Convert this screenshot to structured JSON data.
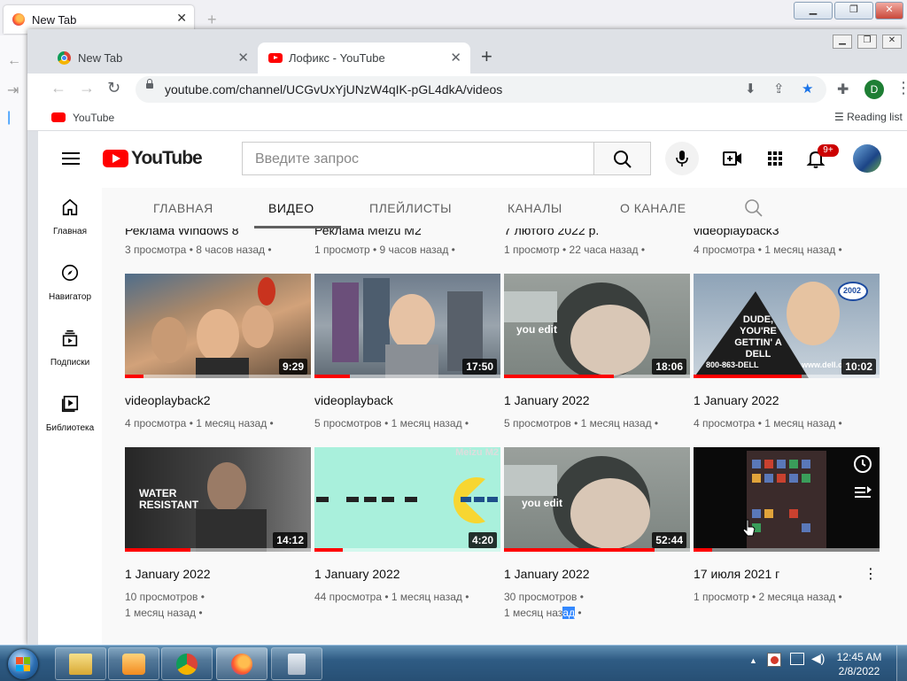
{
  "firefox": {
    "tab_title": "New Tab",
    "tab_close": "✕",
    "new_tab": "+",
    "win_minimize": "▁",
    "win_maximize": "❐",
    "win_close": "✕"
  },
  "chrome": {
    "tabs": [
      {
        "title": "New Tab",
        "close": "✕"
      },
      {
        "title": "Лофикс - YouTube",
        "close": "✕"
      }
    ],
    "new_tab": "+",
    "win_minimize": "▁",
    "win_maximize": "❐",
    "win_close": "✕",
    "url": "youtube.com/channel/UCGvUxYjUNzW4qIK-pGL4dkA/videos",
    "profile_initial": "D",
    "bookmark_label": "YouTube",
    "reading_list": "Reading list"
  },
  "youtube": {
    "wordmark": "YouTube",
    "search_placeholder": "Введите запрос",
    "notification_count": "9+",
    "left_nav": [
      "Главная",
      "Навигатор",
      "Подписки",
      "Библиотека"
    ],
    "channel_tabs": [
      "ГЛАВНАЯ",
      "ВИДЕО",
      "ПЛЕЙЛИСТЫ",
      "КАНАЛЫ",
      "О КАНАЛЕ"
    ],
    "active_tab": "ВИДЕО",
    "cut_row": [
      {
        "title": "Реклама Windows 8",
        "meta": "3 просмотра • 8 часов назад •"
      },
      {
        "title": "Реклама Meizu M2",
        "meta": "1 просмотр • 9 часов назад •"
      },
      {
        "title": "7 лютого 2022 р.",
        "meta": "1 просмотр • 22 часа назад •"
      },
      {
        "title": "videoplayback3",
        "meta": "4 просмотра • 1 месяц назад •"
      }
    ],
    "row2": [
      {
        "title": "videoplayback2",
        "duration": "9:29",
        "meta": "4 просмотра • 1 месяц назад •",
        "progress": 0.1
      },
      {
        "title": "videoplayback",
        "duration": "17:50",
        "meta": "5 просмотров • 1 месяц назад •",
        "progress": 0.19
      },
      {
        "title": "1 January 2022",
        "duration": "18:06",
        "meta": "5 просмотров • 1 месяц назад •",
        "progress": 0.59,
        "overlay": "you edit"
      },
      {
        "title": "1 January 2022",
        "duration": "10:02",
        "meta": "4 просмотра • 1 месяц назад •",
        "progress": 0.58,
        "overlay": "DUDE, YOU'RE GETTIN' A DELL",
        "overlay2": "800-863-DELL",
        "overlay3": "www.dell.com",
        "overlay4": "2002"
      }
    ],
    "row3": [
      {
        "title": "1 January 2022",
        "duration": "14:12",
        "meta1": "10 просмотров •",
        "meta2": "1 месяц назад •",
        "progress": 0.35,
        "overlay": "WATER RESISTANT"
      },
      {
        "title": "1 January 2022",
        "duration": "4:20",
        "meta": "44 просмотра • 1 месяц назад •",
        "progress": 0.15,
        "overlay": "Meizu M2"
      },
      {
        "title": "1 January 2022",
        "duration": "52:44",
        "meta1": "30 просмотров •",
        "meta2a": "1 месяц наз",
        "meta2b": "ад",
        "meta2c": " •",
        "progress": 0.81,
        "overlay": "you edit"
      },
      {
        "title": "17 июля 2021 г",
        "meta": "1 просмотр • 2 месяца назад •",
        "progress": 0.1,
        "kebab": "⋮"
      }
    ]
  },
  "taskbar": {
    "time": "12:45 AM",
    "date": "2/8/2022",
    "tray_arrow": "▲"
  },
  "colors": {
    "yt_red": "#ff0000",
    "chrome_blue": "#1a73e8",
    "taskbar": "#2f5c84"
  }
}
